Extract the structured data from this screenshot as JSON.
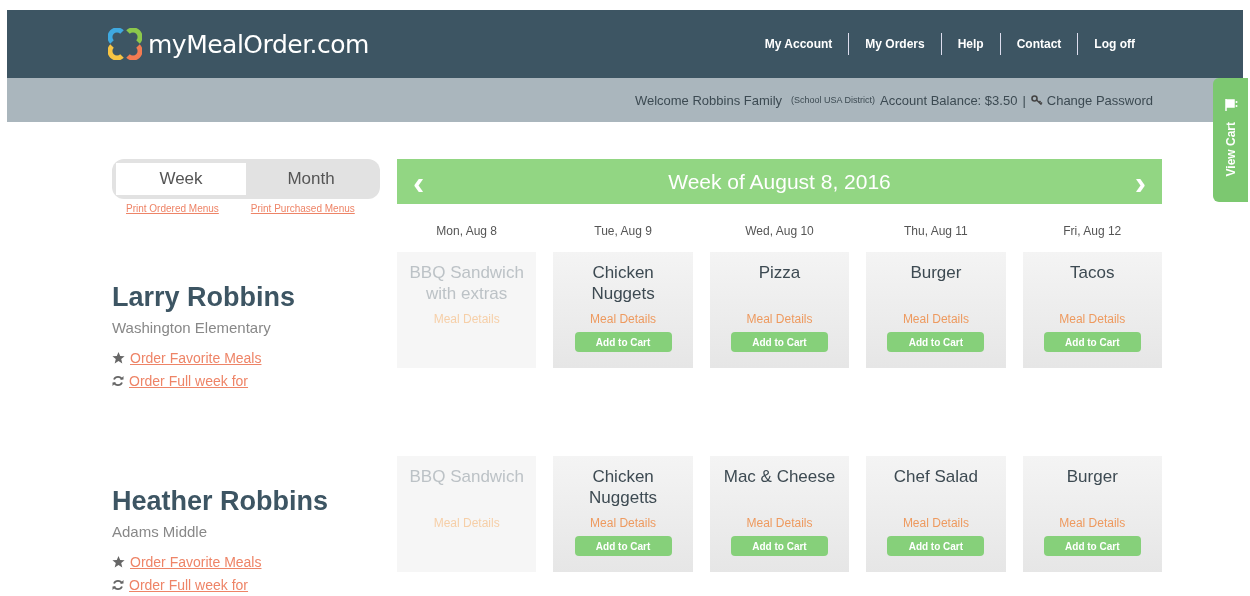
{
  "header": {
    "logo": "myMealOrder.com",
    "nav": [
      "My Account",
      "My Orders",
      "Help",
      "Contact",
      "Log off"
    ]
  },
  "subbar": {
    "welcome": "Welcome Robbins Family",
    "district": "(School USA District)",
    "balance": "Account Balance: $3.50",
    "separator": "|",
    "change_password": "Change Password"
  },
  "cart_tab": {
    "label": "View Cart"
  },
  "view_toggle": [
    {
      "label": "Week",
      "selected": true
    },
    {
      "label": "Month",
      "selected": false
    }
  ],
  "print_links": [
    "Print Ordered Menus",
    "Print Purchased Menus"
  ],
  "week_bar": {
    "prev": "‹",
    "title": "Week of August 8, 2016",
    "next": "›"
  },
  "days": [
    "Mon, Aug 8",
    "Tue, Aug 9",
    "Wed, Aug 10",
    "Thu, Aug 11",
    "Fri, Aug 12"
  ],
  "students": [
    {
      "name": "Larry Robbins",
      "school": "Washington Elementary",
      "links": [
        {
          "kind": "favorite",
          "label": "Order Favorite Meals"
        },
        {
          "kind": "repeat",
          "label": "Order Full week for"
        }
      ],
      "meals": [
        {
          "name": "BBQ Sandwich with extras",
          "details": "Meal Details",
          "disabled": true
        },
        {
          "name": "Chicken Nuggets",
          "details": "Meal Details",
          "disabled": false,
          "button": "Add to Cart"
        },
        {
          "name": "Pizza",
          "details": "Meal Details",
          "disabled": false,
          "button": "Add to Cart"
        },
        {
          "name": "Burger",
          "details": "Meal Details",
          "disabled": false,
          "button": "Add to Cart"
        },
        {
          "name": "Tacos",
          "details": "Meal Details",
          "disabled": false,
          "button": "Add to Cart"
        }
      ]
    },
    {
      "name": "Heather Robbins",
      "school": "Adams Middle",
      "links": [
        {
          "kind": "favorite",
          "label": "Order Favorite Meals"
        },
        {
          "kind": "repeat",
          "label": "Order Full week for"
        }
      ],
      "meals": [
        {
          "name": "BBQ Sandwich",
          "details": "Meal Details",
          "disabled": true
        },
        {
          "name": "Chicken Nuggetts",
          "details": "Meal Details",
          "disabled": false,
          "button": "Add to Cart"
        },
        {
          "name": "Mac & Cheese",
          "details": "Meal Details",
          "disabled": false,
          "button": "Add to Cart"
        },
        {
          "name": "Chef Salad",
          "details": "Meal Details",
          "disabled": false,
          "button": "Add to Cart"
        },
        {
          "name": "Burger",
          "details": "Meal Details",
          "disabled": false,
          "button": "Add to Cart"
        }
      ]
    }
  ]
}
